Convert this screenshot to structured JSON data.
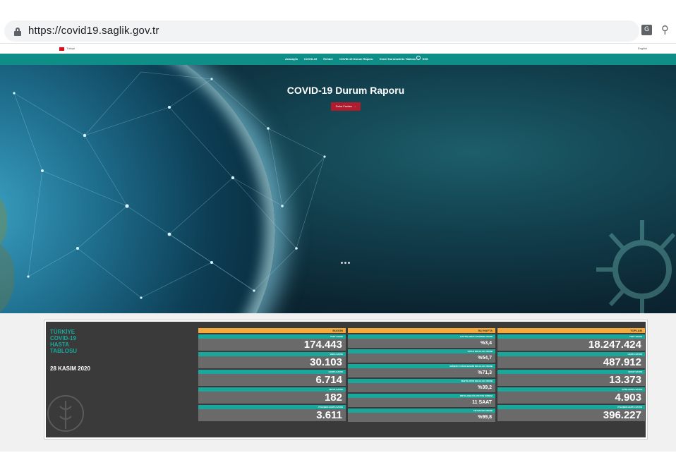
{
  "browser": {
    "url": "https://covid19.saglik.gov.tr"
  },
  "site": {
    "lang_left": "Türkçe",
    "lang_right": "English",
    "nav": [
      "Anasayfa",
      "COVID-19",
      "Rehber",
      "COVID-19 Durum Raporu",
      "Genel Koronavirüs Tablosu",
      "SSS"
    ]
  },
  "hero": {
    "title": "COVID-19 Durum Raporu",
    "button": "Daha Fazlası"
  },
  "table": {
    "title_lines": [
      "TÜRKİYE",
      "COVID-19",
      "HASTA",
      "TABLOSU"
    ],
    "date": "28 KASIM 2020",
    "columns": [
      {
        "header": "BUGÜN",
        "metrics": [
          {
            "label": "TEST SAYISI",
            "value": "174.443"
          },
          {
            "label": "VAKA SAYISI",
            "value": "30.103"
          },
          {
            "label": "HASTA SAYISI",
            "value": "6.714"
          },
          {
            "label": "VEFAT SAYISI",
            "value": "182"
          },
          {
            "label": "İYİLEŞEN HASTA SAYISI",
            "value": "3.611"
          }
        ]
      },
      {
        "header": "BU HAFTA",
        "metrics": [
          {
            "label": "HASTALARDA ZATÜRRE ORANI",
            "value": "%3,4"
          },
          {
            "label": "YATAK DOLULUK ORANI",
            "value": "%54,7"
          },
          {
            "label": "ERİŞKİN YOĞUN BAKIM DOLULUK ORANI",
            "value": "%71,3"
          },
          {
            "label": "VENTİLATÖR DOLULUK ORANI",
            "value": "%39,2"
          },
          {
            "label": "ORTALAMA FİLYASYON SÜRESİ",
            "value": "11 SAAT"
          },
          {
            "label": "FİLYASYON ORANI",
            "value": "%99,8"
          }
        ]
      },
      {
        "header": "TOPLAM",
        "metrics": [
          {
            "label": "TEST SAYISI",
            "value": "18.247.424"
          },
          {
            "label": "HASTA SAYISI",
            "value": "487.912"
          },
          {
            "label": "VEFAT SAYISI",
            "value": "13.373"
          },
          {
            "label": "AĞIR HASTA SAYISI",
            "value": "4.903"
          },
          {
            "label": "İYİLEŞEN HASTA SAYISI",
            "value": "396.227"
          }
        ]
      }
    ]
  },
  "colors": {
    "teal": "#19a79c",
    "orange": "#f4a93a",
    "dark": "#3a3a3a",
    "red_button": "#b01c2e"
  }
}
